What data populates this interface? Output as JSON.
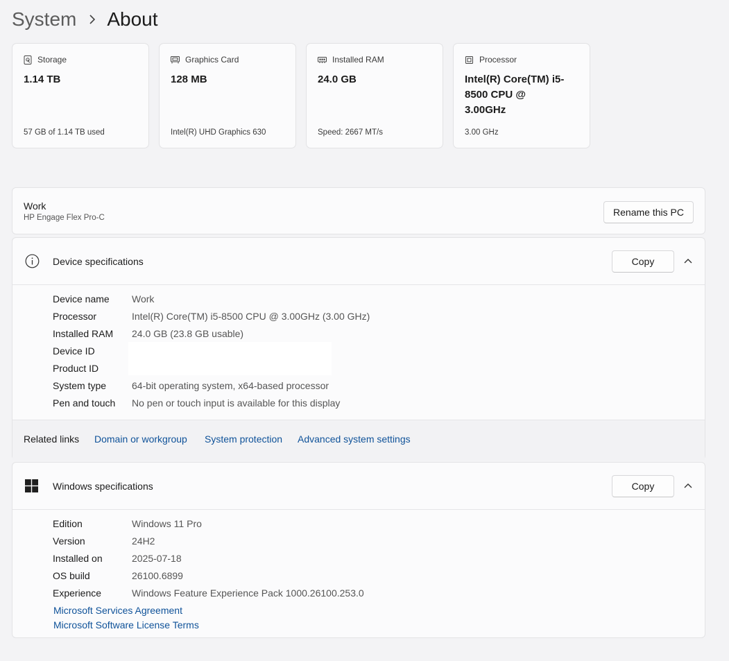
{
  "breadcrumb": {
    "parent": "System",
    "separator_icon": "chevron-right-icon",
    "current": "About"
  },
  "cards": [
    {
      "icon": "storage-icon",
      "label": "Storage",
      "value": "1.14 TB",
      "detail": "57 GB of 1.14 TB used"
    },
    {
      "icon": "graphics-card-icon",
      "label": "Graphics Card",
      "value": "128 MB",
      "detail": "Intel(R) UHD Graphics 630"
    },
    {
      "icon": "ram-icon",
      "label": "Installed RAM",
      "value": "24.0 GB",
      "detail": "Speed: 2667 MT/s"
    },
    {
      "icon": "processor-icon",
      "label": "Processor",
      "value": "Intel(R) Core(TM) i5-8500 CPU @ 3.00GHz",
      "detail": "3.00 GHz"
    }
  ],
  "pc": {
    "name": "Work",
    "model": "HP Engage Flex Pro-C",
    "rename_label": "Rename this PC"
  },
  "device_specs": {
    "icon": "info-icon",
    "title": "Device specifications",
    "copy_label": "Copy",
    "rows": [
      {
        "label": "Device name",
        "value": "Work"
      },
      {
        "label": "Processor",
        "value": "Intel(R) Core(TM) i5-8500 CPU @ 3.00GHz (3.00 GHz)"
      },
      {
        "label": "Installed RAM",
        "value": "24.0 GB (23.8 GB usable)"
      },
      {
        "label": "Device ID",
        "value": ""
      },
      {
        "label": "Product ID",
        "value": ""
      },
      {
        "label": "System type",
        "value": "64-bit operating system, x64-based processor"
      },
      {
        "label": "Pen and touch",
        "value": "No pen or touch input is available for this display"
      }
    ]
  },
  "related_links": {
    "label": "Related links",
    "links": [
      "Domain or workgroup",
      "System protection",
      "Advanced system settings"
    ]
  },
  "windows_specs": {
    "icon": "windows-logo-icon",
    "title": "Windows specifications",
    "copy_label": "Copy",
    "rows": [
      {
        "label": "Edition",
        "value": "Windows 11 Pro"
      },
      {
        "label": "Version",
        "value": "24H2"
      },
      {
        "label": "Installed on",
        "value": "2025-07-18"
      },
      {
        "label": "OS build",
        "value": "26100.6899"
      },
      {
        "label": "Experience",
        "value": "Windows Feature Experience Pack 1000.26100.253.0"
      }
    ],
    "links": [
      "Microsoft Services Agreement",
      "Microsoft Software License Terms"
    ]
  },
  "colors": {
    "link": "#0f5299",
    "background": "#f3f3f5",
    "card": "#fbfbfc"
  }
}
